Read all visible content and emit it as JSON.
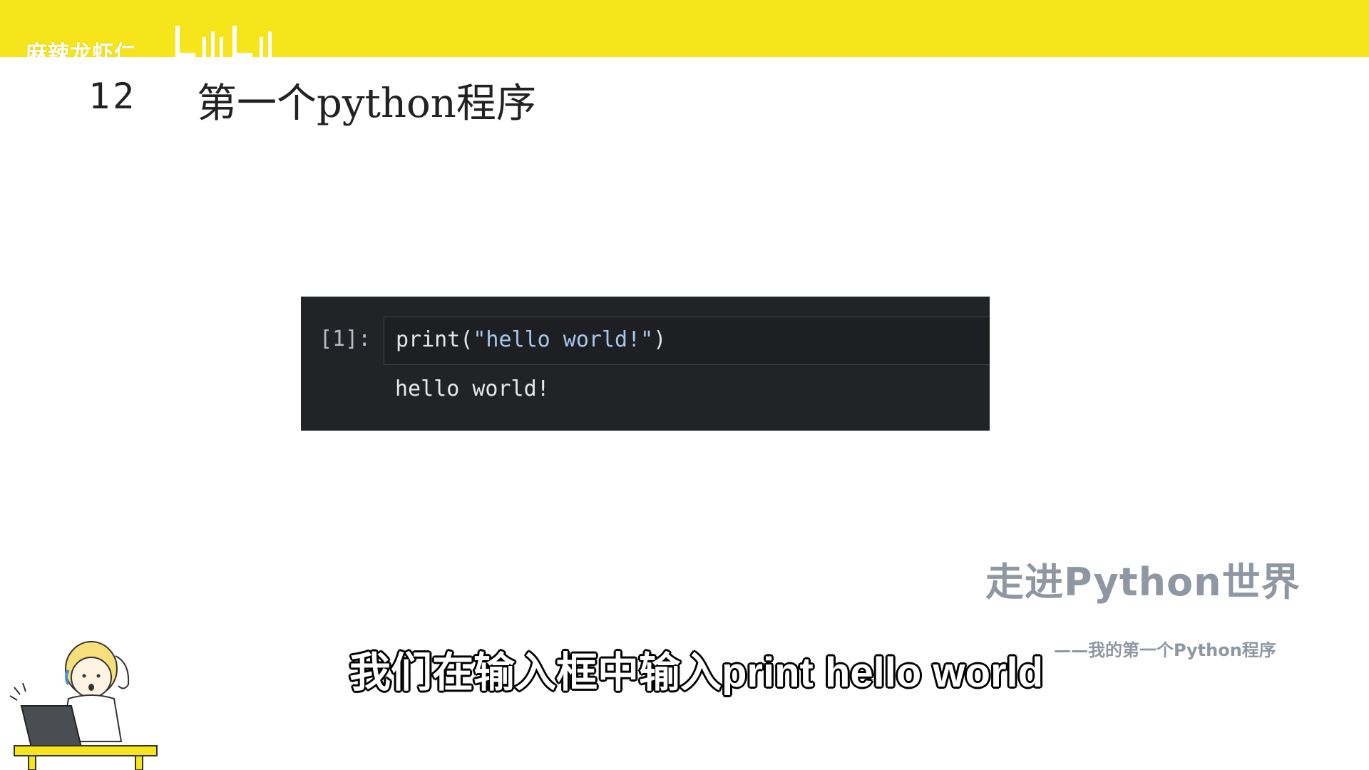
{
  "header": {
    "channel_watermark": "麻辣龙虾仁",
    "bar_color": "#f5e51a"
  },
  "slide": {
    "number": "12",
    "title": "第一个python程序"
  },
  "notebook": {
    "prompt": "[1]:",
    "code_func": "print(",
    "code_string": "\"hello world!\"",
    "code_close": ")",
    "output": "hello world!"
  },
  "section": {
    "title": "走进Python世界",
    "subtitle": "——我的第一个Python程序"
  },
  "caption": {
    "text": "我们在输入框中输入print hello world"
  },
  "icons": {
    "logo": "bilibili-logo",
    "mascot": "student-at-laptop-illustration"
  }
}
